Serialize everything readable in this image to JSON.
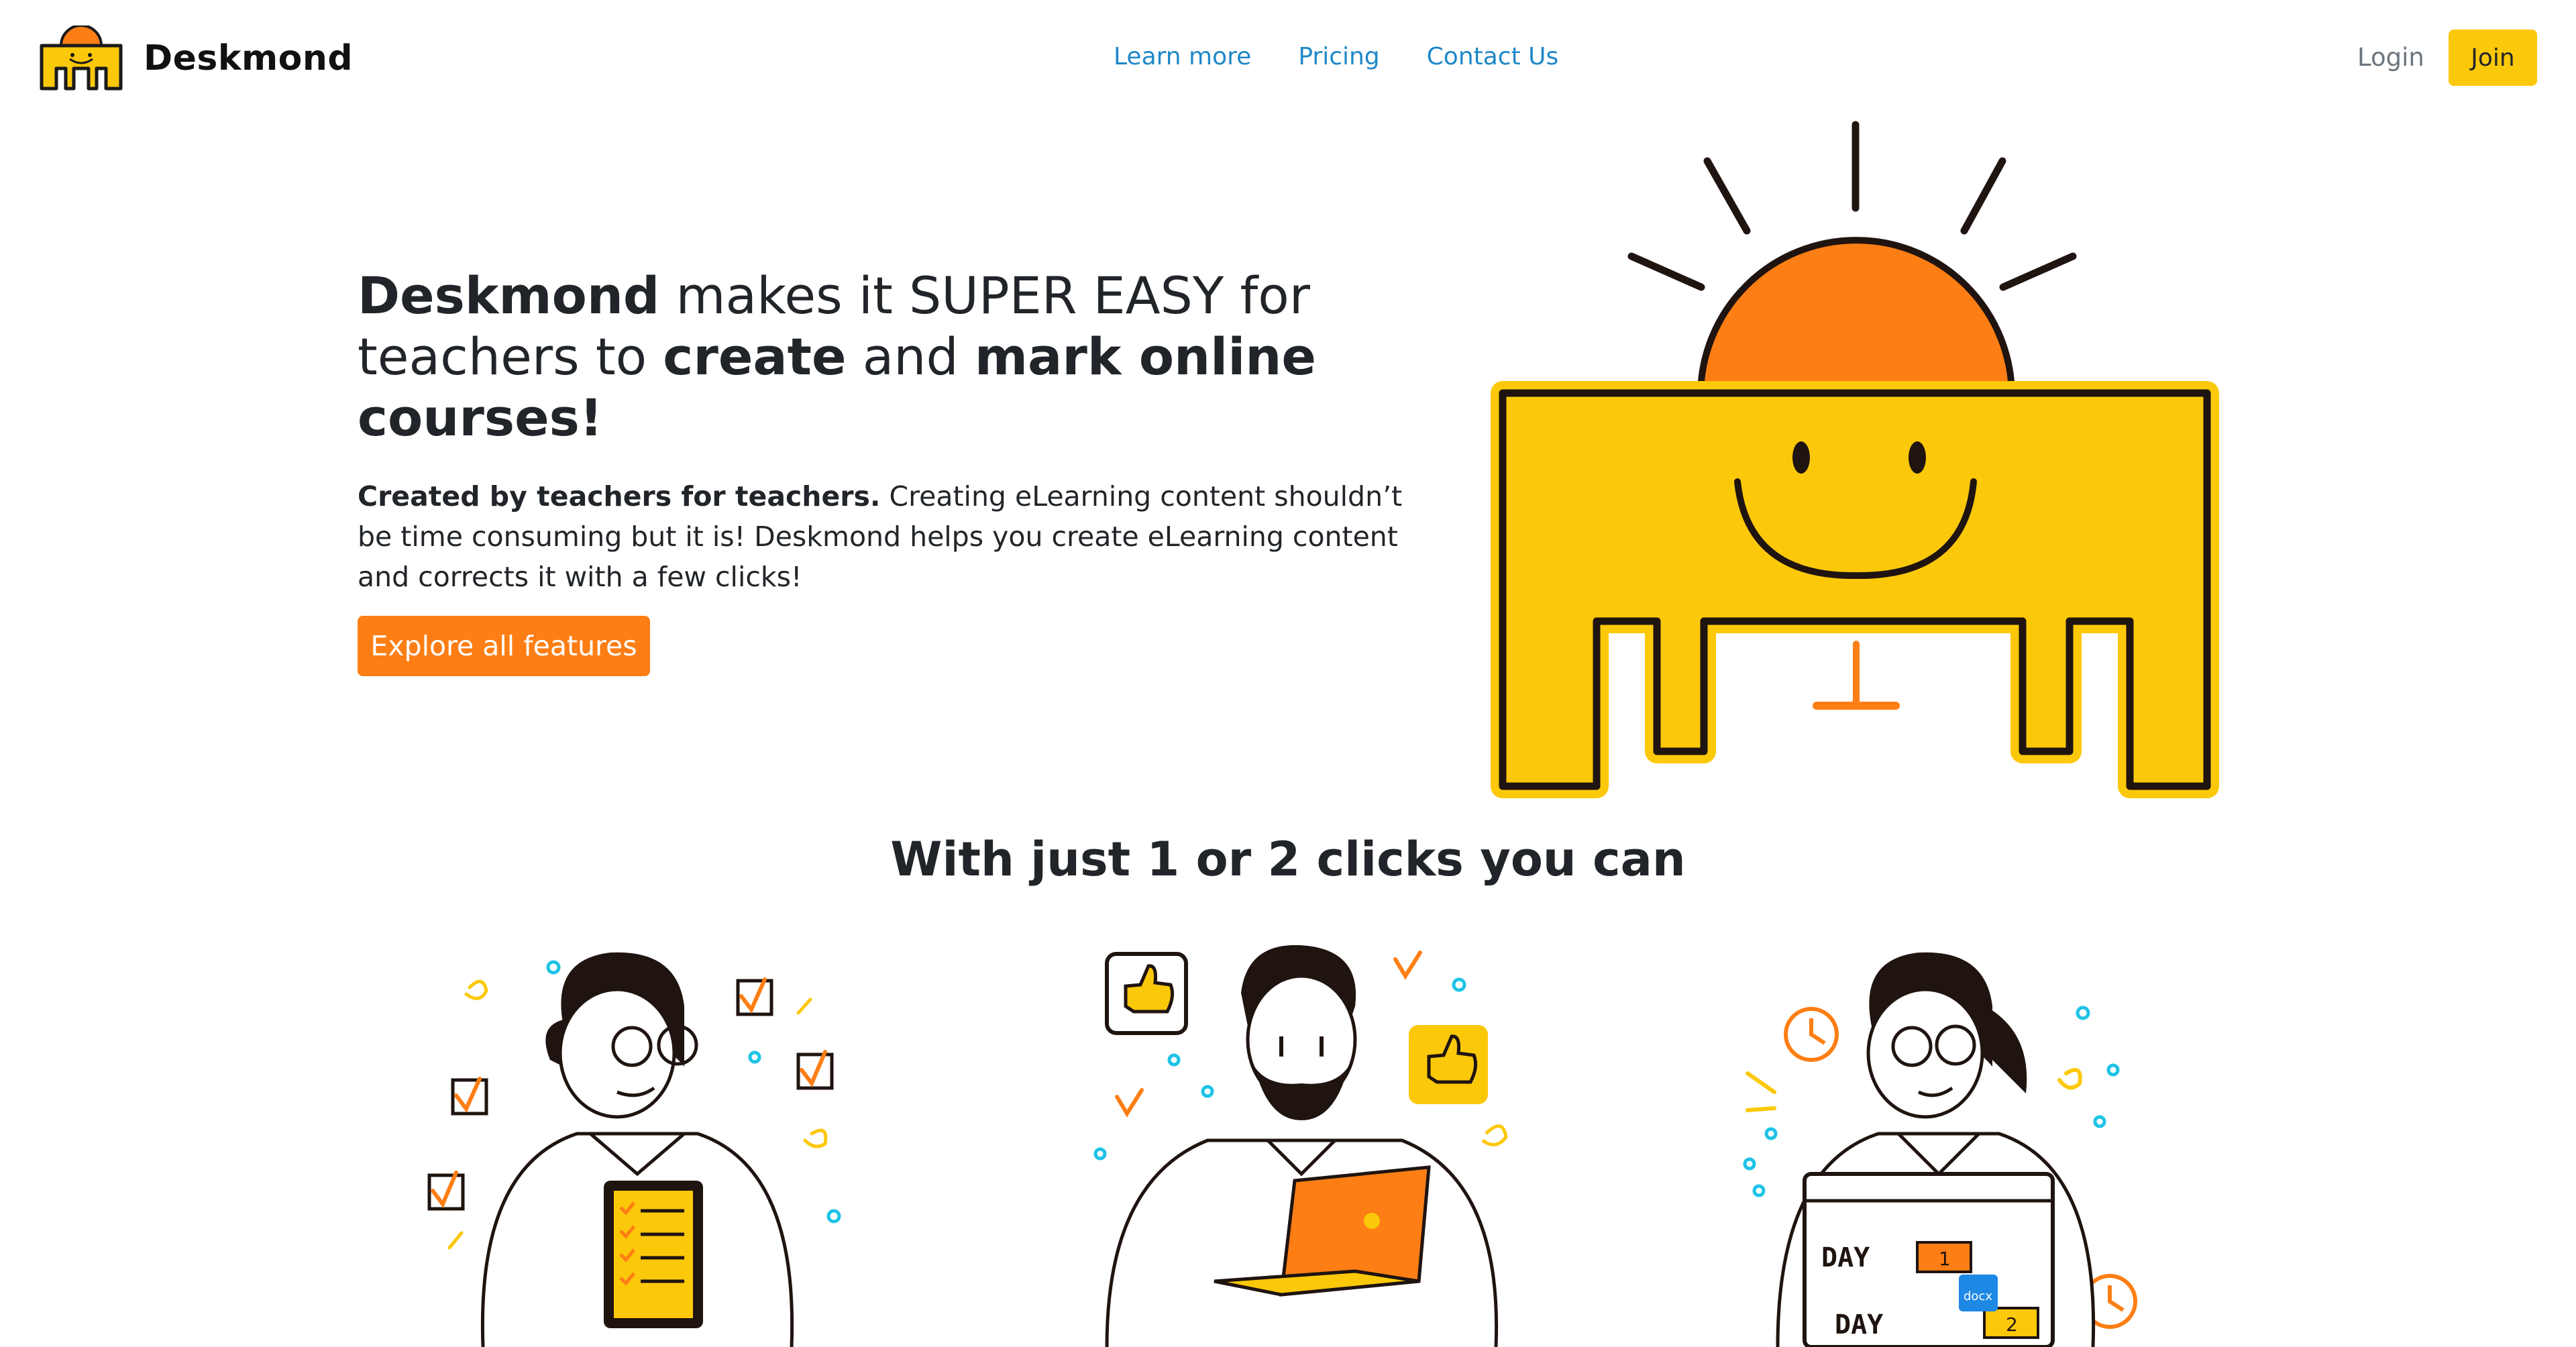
{
  "nav": {
    "brand_name": "Deskmond",
    "links": [
      "Learn more",
      "Pricing",
      "Contact Us"
    ],
    "login_label": "Login",
    "join_label": "Join"
  },
  "hero": {
    "headline": {
      "p1": "Deskmond",
      "p2": " makes it SUPER EASY for teachers to ",
      "p3": "create",
      "p4": " and ",
      "p5": "mark online courses!"
    },
    "lead_bold": "Created by teachers for teachers.",
    "lead_text": " Creating eLearning content shouldn’t be time consuming but it is! Deskmond helps you create eLearning content and corrects it with a few clicks!",
    "cta_label": "Explore all features"
  },
  "features": {
    "title": "With just 1 or 2 clicks you can",
    "day_label_1": "DAY",
    "day_number_1": "1",
    "day_label_2": "DAY",
    "day_number_2": "2",
    "file_badge": "docx"
  },
  "colors": {
    "yellow": "#fcc80a",
    "orange": "#fd7e14",
    "link_blue": "#1e88c8",
    "text": "#212529",
    "muted": "#6c757d"
  },
  "icons": [
    "desk-smiley-logo-icon",
    "thumbs-up-icon",
    "checkbox-icon",
    "clock-icon",
    "laptop-icon",
    "tablet-checklist-icon",
    "calendar-icon"
  ]
}
